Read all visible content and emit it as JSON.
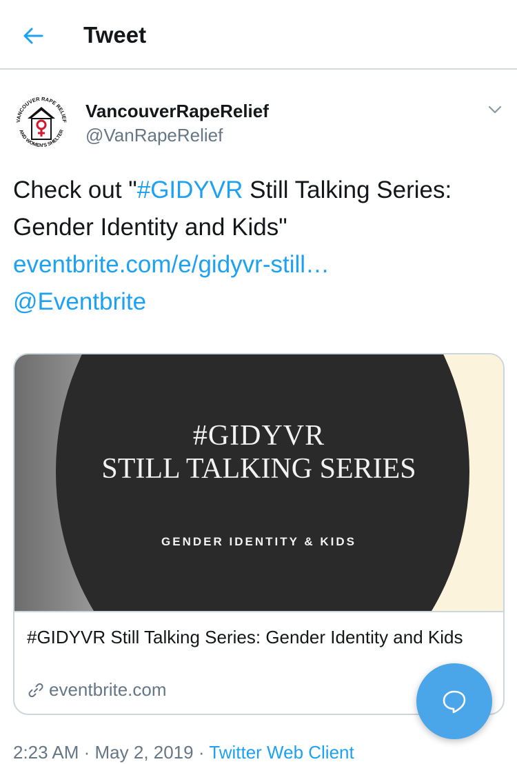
{
  "header": {
    "title": "Tweet",
    "back_icon": "arrow-left-icon"
  },
  "author": {
    "name": "VancouverRapeRelief",
    "handle": "@VanRapeRelief",
    "avatar_text_top": "VANCOUVER RAPE RELIEF",
    "avatar_text_bottom": "AND WOMEN'S SHELTER",
    "menu_icon": "chevron-down-icon"
  },
  "tweet": {
    "prefix": "Check out \"",
    "hashtag": "#GIDYVR",
    "middle": " Still Talking Series: Gender Identity and Kids\"",
    "link": "eventbrite.com/e/gidyvr-still…",
    "mention": "@Eventbrite"
  },
  "card": {
    "image_line1": "#GIDYVR",
    "image_line2": "STILL TALKING SERIES",
    "image_subtitle": "GENDER IDENTITY & KIDS",
    "title": "#GIDYVR Still Talking Series: Gender Identity and Kids",
    "domain": "eventbrite.com",
    "domain_icon": "link-icon"
  },
  "meta": {
    "time": "2:23 AM",
    "sep1": " · ",
    "date": "May 2, 2019",
    "sep2": " · ",
    "client": "Twitter Web Client"
  },
  "fab": {
    "icon": "reply-bubble-icon"
  },
  "colors": {
    "accent": "#1da1f2",
    "text": "#14171a",
    "secondary": "#657786",
    "fab": "#4aa6e9"
  }
}
